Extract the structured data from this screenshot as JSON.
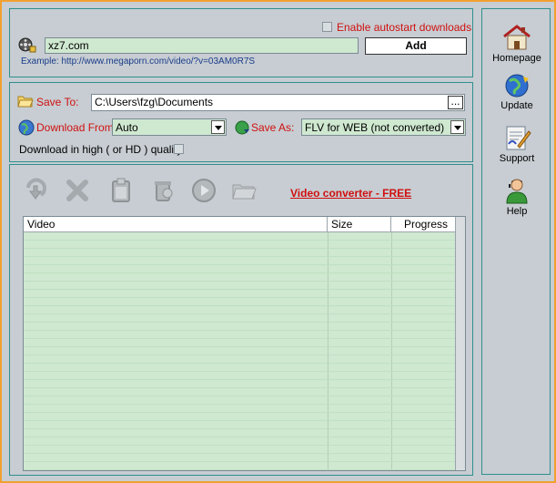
{
  "url_panel": {
    "autostart_label": "Enable autostart downloads",
    "url_value": "xz7.com",
    "add_label": "Add",
    "example_text": "Example: http://www.megaporn.com/video/?v=03AM0R7S"
  },
  "save_panel": {
    "save_to_label": "Save To:",
    "save_to_value": "C:\\Users\\fzg\\Documents",
    "browse_label": "...",
    "download_from_label": "Download From:",
    "download_from_value": "Auto",
    "save_as_label": "Save As:",
    "save_as_value": "FLV for WEB (not converted)",
    "hq_label": "Download in high ( or HD ) quality"
  },
  "list_panel": {
    "converter_link": "Video converter - FREE",
    "columns": [
      "Video",
      "Size",
      "Progress"
    ]
  },
  "sidebar": {
    "items": [
      {
        "label": "Homepage",
        "icon": "home-icon"
      },
      {
        "label": "Update",
        "icon": "globe-update-icon"
      },
      {
        "label": "Support",
        "icon": "support-icon"
      },
      {
        "label": "Help",
        "icon": "help-person-icon"
      }
    ]
  },
  "colors": {
    "accent_red": "#d01010",
    "field_bg": "#cfe8d0",
    "panel_bg": "#c7cdd2",
    "frame": "#f1a030"
  }
}
